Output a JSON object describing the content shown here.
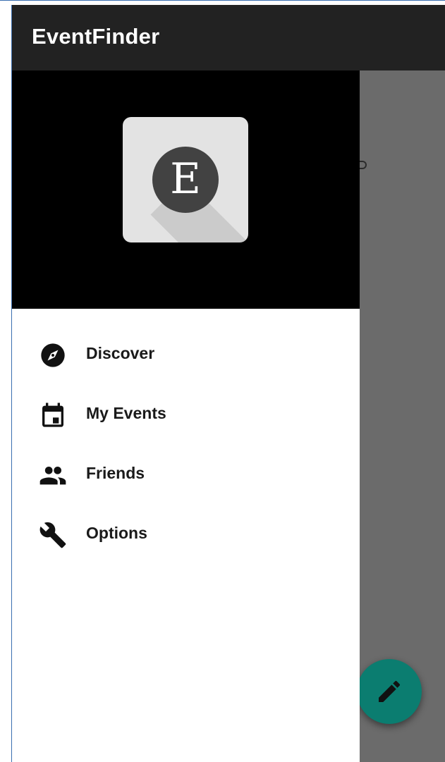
{
  "app": {
    "title": "EventFinder"
  },
  "drawer": {
    "logo_letter": "E",
    "items": [
      {
        "label": "Discover",
        "icon": "compass-icon"
      },
      {
        "label": "My Events",
        "icon": "calendar-icon"
      },
      {
        "label": "Friends",
        "icon": "people-icon"
      },
      {
        "label": "Options",
        "icon": "wrench-icon"
      }
    ]
  },
  "fab": {
    "icon": "pencil-icon"
  },
  "colors": {
    "app_bar": "#222222",
    "drawer_header": "#000000",
    "scrim": "#6b6b6b",
    "fab": "#0b7d70",
    "logo_circle": "#424242",
    "logo_tile": "#e3e3e3"
  }
}
